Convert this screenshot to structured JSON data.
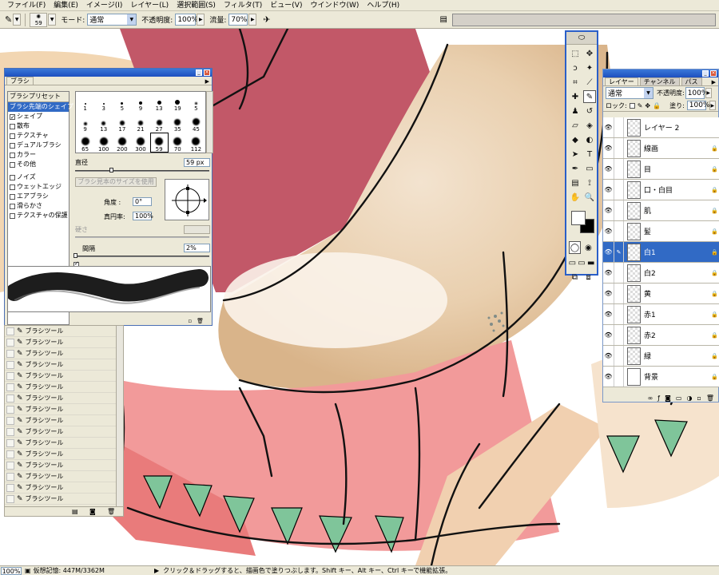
{
  "menu": [
    "ファイル(F)",
    "編集(E)",
    "イメージ(I)",
    "レイヤー(L)",
    "選択範囲(S)",
    "フィルタ(T)",
    "ビュー(V)",
    "ウインドウ(W)",
    "ヘルプ(H)"
  ],
  "options": {
    "brush_size": "59",
    "mode_label": "モード:",
    "mode_value": "通常",
    "opacity_label": "不透明度:",
    "opacity_value": "100%",
    "flow_label": "流量:",
    "flow_value": "70%"
  },
  "brush_panel": {
    "tab": "ブラシ",
    "presets": "ブラシプリセット",
    "tip_shape": "ブラシ先端のシェイプ",
    "options": [
      {
        "label": "シェイプ",
        "checked": true
      },
      {
        "label": "散布",
        "checked": false
      },
      {
        "label": "テクスチャ",
        "checked": false
      },
      {
        "label": "デュアルブラシ",
        "checked": false
      },
      {
        "label": "カラー",
        "checked": false
      },
      {
        "label": "その他",
        "checked": false
      },
      {
        "label": "ノイズ",
        "checked": false
      },
      {
        "label": "ウェットエッジ",
        "checked": false
      },
      {
        "label": "エアブラシ",
        "checked": false
      },
      {
        "label": "滑らかさ",
        "checked": false
      },
      {
        "label": "テクスチャの保護",
        "checked": false
      }
    ],
    "grid_sizes": [
      "1",
      "3",
      "5",
      "9",
      "13",
      "19",
      "5",
      "9",
      "13",
      "17",
      "21",
      "27",
      "35",
      "45",
      "65",
      "100",
      "200",
      "300",
      "59",
      "70",
      "112"
    ],
    "diameter_label": "直径",
    "diameter_value": "59 px",
    "use_sample_size": "ブラシ見本のサイズを使用",
    "angle_label": "角度 :",
    "angle_value": "0°",
    "roundness_label": "真円率:",
    "roundness_value": "100%",
    "hardness_label": "硬さ",
    "spacing_label": "間隔",
    "spacing_checked": true,
    "spacing_value": "2%"
  },
  "tool_rows": [
    "ブラシツール",
    "ブラシツール",
    "ブラシツール",
    "ブラシツール",
    "ブラシツール",
    "ブラシツール",
    "ブラシツール",
    "ブラシツール",
    "ブラシツール",
    "ブラシツール",
    "ブラシツール",
    "ブラシツール",
    "ブラシツール",
    "ブラシツール",
    "ブラシツール",
    "ブラシツール"
  ],
  "layers_panel": {
    "tabs": [
      "レイヤー",
      "チャンネル",
      "パス"
    ],
    "blend_mode": "通常",
    "opacity_label": "不透明度:",
    "opacity_value": "100%",
    "lock_label": "ロック:",
    "fill_label": "塗り:",
    "fill_value": "100%",
    "layers": [
      {
        "name": "レイヤー 2",
        "selected": false,
        "locked": false
      },
      {
        "name": "線画",
        "selected": false,
        "locked": true
      },
      {
        "name": "目",
        "selected": false,
        "locked": true
      },
      {
        "name": "口・白目",
        "selected": false,
        "locked": true
      },
      {
        "name": "肌",
        "selected": false,
        "locked": true
      },
      {
        "name": "髪",
        "selected": false,
        "locked": true
      },
      {
        "name": "白1",
        "selected": true,
        "locked": true
      },
      {
        "name": "白2",
        "selected": false,
        "locked": true
      },
      {
        "name": "黄",
        "selected": false,
        "locked": true
      },
      {
        "name": "赤1",
        "selected": false,
        "locked": true
      },
      {
        "name": "赤2",
        "selected": false,
        "locked": true
      },
      {
        "name": "緑",
        "selected": false,
        "locked": true
      },
      {
        "name": "背景",
        "selected": false,
        "locked": true
      }
    ]
  },
  "status": {
    "zoom": "100%",
    "memory": "仮想記憶: 447M/3362M",
    "hint": "クリック＆ドラッグすると、描画色で塗りつぶします。Shift キー、Alt キー、Ctrl キーで機能拡張。"
  }
}
